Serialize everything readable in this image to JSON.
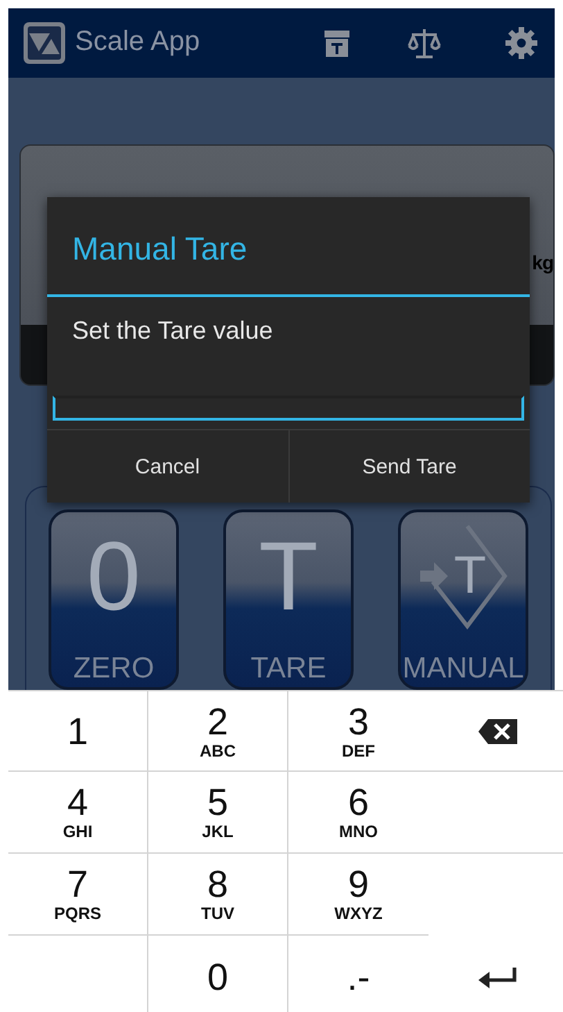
{
  "app_bar": {
    "title": "Scale App"
  },
  "display": {
    "unit": "kg"
  },
  "actions": [
    {
      "kind": "glyph",
      "glyph": "0",
      "label": "ZERO"
    },
    {
      "kind": "glyph",
      "glyph": "T",
      "label": "TARE"
    },
    {
      "kind": "manual",
      "glyph": "T",
      "label": "MANUAL"
    }
  ],
  "dialog": {
    "title": "Manual Tare",
    "message": "Set the Tare value",
    "buttons": [
      "Cancel",
      "Send Tare"
    ]
  },
  "keyboard": {
    "keys": [
      {
        "kind": "digit",
        "digit": "1"
      },
      {
        "kind": "digit",
        "digit": "2",
        "letters": "ABC"
      },
      {
        "kind": "digit",
        "digit": "3",
        "letters": "DEF"
      },
      {
        "kind": "backspace"
      },
      {
        "kind": "digit",
        "digit": "4",
        "letters": "GHI"
      },
      {
        "kind": "digit",
        "digit": "5",
        "letters": "JKL"
      },
      {
        "kind": "digit",
        "digit": "6",
        "letters": "MNO"
      },
      {
        "kind": "blank"
      },
      {
        "kind": "digit",
        "digit": "7",
        "letters": "PQRS"
      },
      {
        "kind": "digit",
        "digit": "8",
        "letters": "TUV"
      },
      {
        "kind": "digit",
        "digit": "9",
        "letters": "WXYZ"
      },
      {
        "kind": "blank"
      },
      {
        "kind": "blank"
      },
      {
        "kind": "digit",
        "digit": "0"
      },
      {
        "kind": "digit",
        "digit": ".-"
      },
      {
        "kind": "enter"
      }
    ]
  }
}
